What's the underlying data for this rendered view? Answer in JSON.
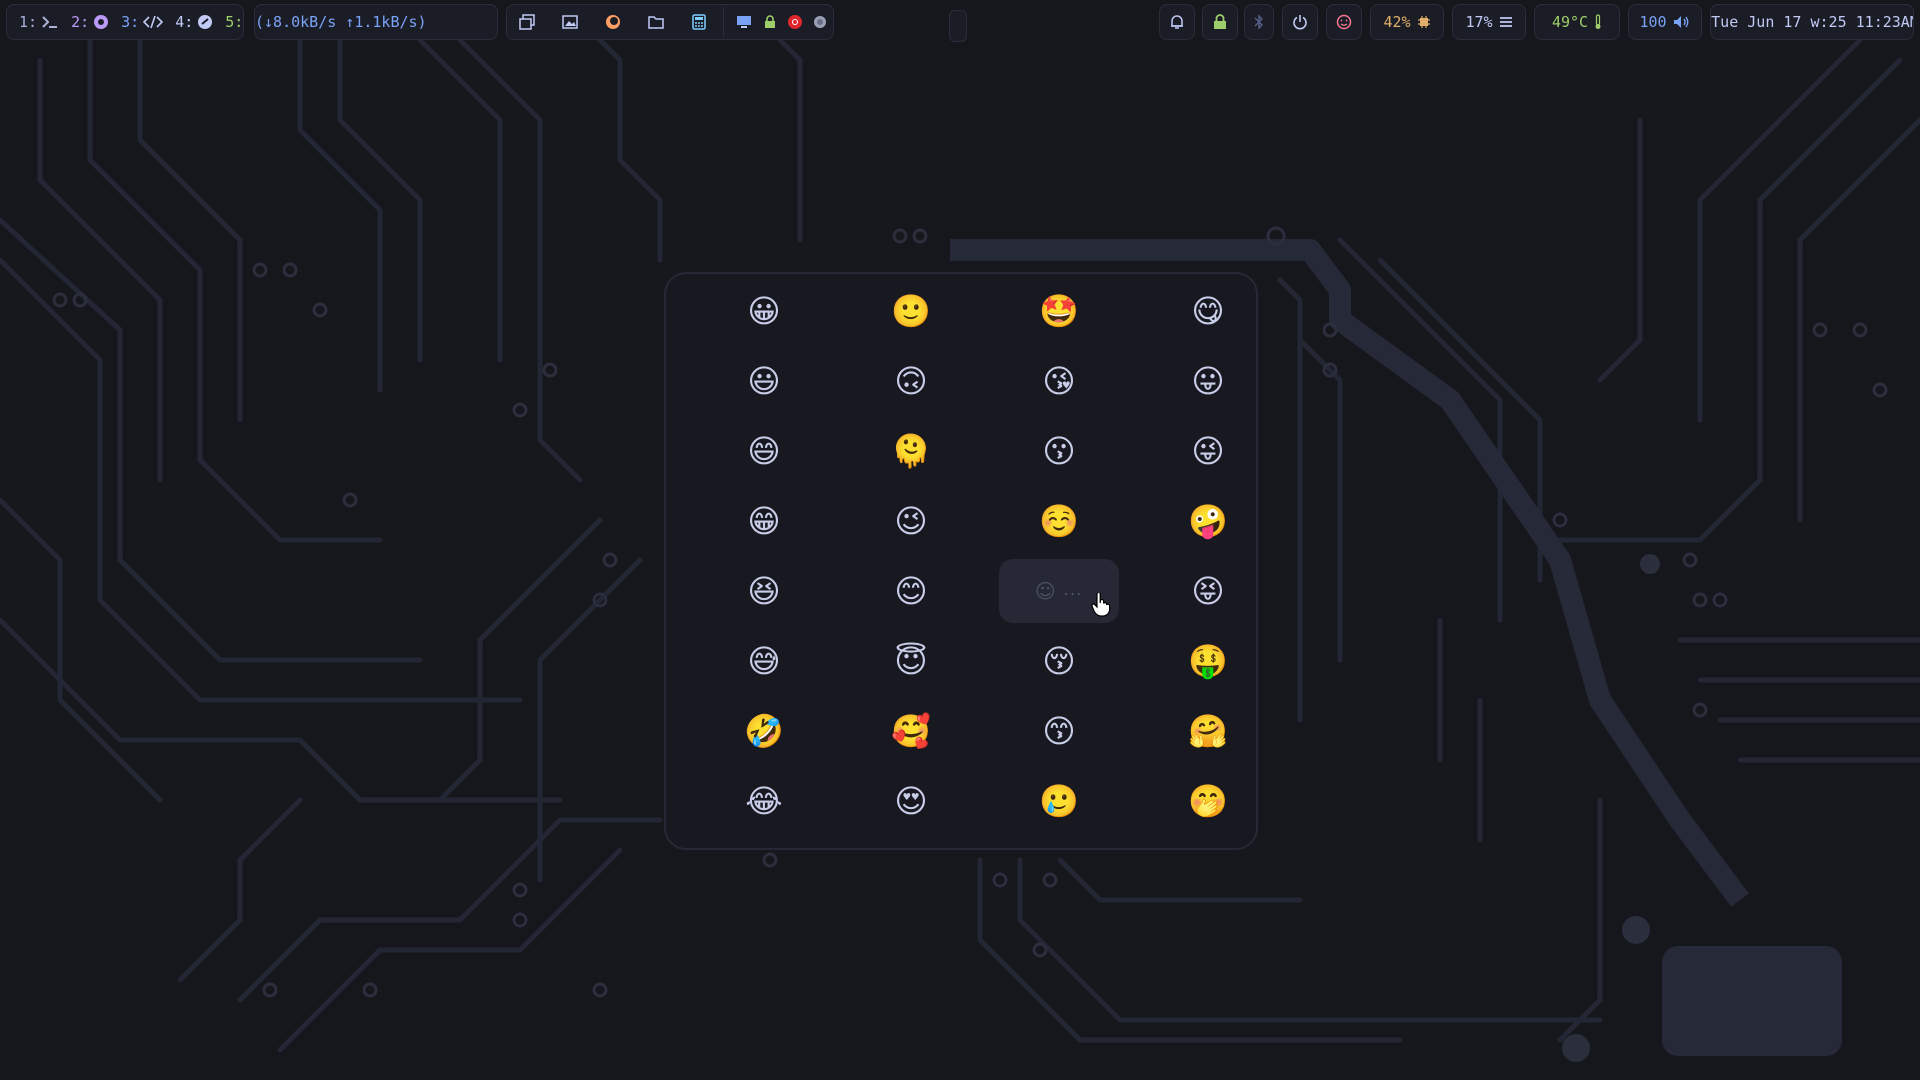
{
  "workspaces": [
    {
      "num": "1:",
      "icon": "terminal-icon"
    },
    {
      "num": "2:",
      "icon": "chrome-icon"
    },
    {
      "num": "3:",
      "icon": "code-icon"
    },
    {
      "num": "4:",
      "icon": "app-icon"
    },
    {
      "num": "5:",
      "icon": "chameleon-icon"
    }
  ],
  "network": "(↓8.0kB/s ↑1.1kB/s)",
  "launchers": [
    "windows-icon",
    "image-icon",
    "firefox-icon",
    "folder-icon",
    "calculator-icon"
  ],
  "tray": [
    "monitor-icon",
    "lock-tray-icon",
    "record-icon",
    "circle-icon"
  ],
  "status": {
    "cpu": "42%",
    "ram": "17%",
    "temp": "49°C",
    "volume": "100",
    "clock": "Tue Jun 17 w:25 11:23AM"
  },
  "emoji_panel": {
    "rows": [
      [
        "😀",
        "🙂",
        "🤩",
        "😋"
      ],
      [
        "😃",
        "🙃",
        "😘",
        "😛"
      ],
      [
        "😄",
        "🫠",
        "😗",
        "😜"
      ],
      [
        "😁",
        "😉",
        "☺️",
        "🤪"
      ],
      [
        "😆",
        "😊",
        "",
        "😝"
      ],
      [
        "😅",
        "😇",
        "😚",
        "🤑"
      ],
      [
        "🤣",
        "🥰",
        "😙",
        "🤗"
      ],
      [
        "😂",
        "😍",
        "🥲",
        "🤭"
      ]
    ],
    "loading_glyph": "☺",
    "loading_dots": "...",
    "colors": {
      "accent": "#7aa2f7",
      "panel": "#171820",
      "hover": "#262935"
    }
  }
}
